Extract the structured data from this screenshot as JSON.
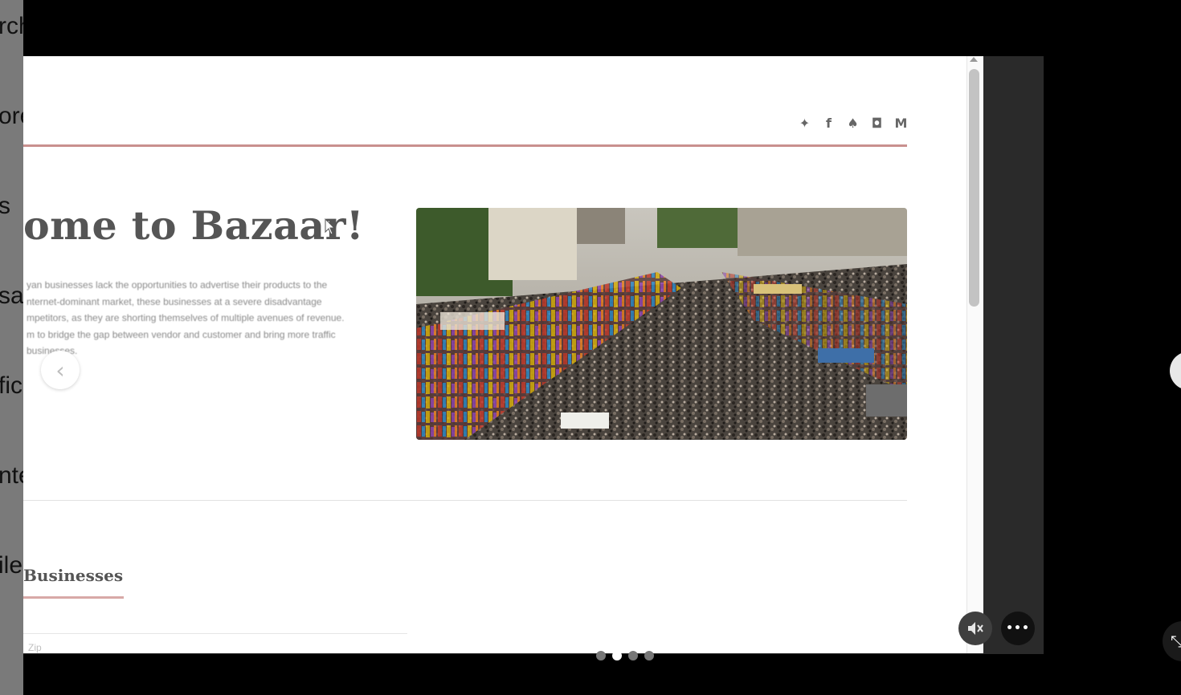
{
  "left_sidebar": {
    "items": [
      "rch",
      "ore",
      "s",
      "sa",
      "fic",
      "nte",
      "ile"
    ]
  },
  "site": {
    "social_icons": [
      {
        "icon": "twitter-icon",
        "glyph": "🐦"
      },
      {
        "icon": "facebook-icon",
        "glyph": "f"
      },
      {
        "icon": "snapchat-icon",
        "glyph": "👻"
      },
      {
        "icon": "instagram-icon",
        "glyph": "◎"
      },
      {
        "icon": "medium-icon",
        "glyph": "M"
      }
    ],
    "social_glyphs": {
      "twitter": "✦",
      "facebook": "f",
      "snapchat": "♠",
      "instagram": "◘",
      "medium": "M"
    },
    "hero_title": "ome to Bazaar!",
    "hero_paragraph": [
      "yan businesses lack the opportunities to advertise their products to the",
      "nternet-dominant market, these businesses at a severe disadvantage",
      "mpetitors, as they are shorting themselves of multiple avenues of revenue.",
      "m to bridge the gap between vendor and customer and bring more traffic",
      " businesses."
    ],
    "section_title": "Businesses",
    "zip_placeholder": "Zip"
  },
  "viewer": {
    "prev_icon": "‹",
    "more_icon": "•••",
    "mute_icon": "🔇",
    "expand_icon": "⤡",
    "slide_count": 4,
    "active_slide": 2
  },
  "colors": {
    "accent_rule": "#c9908e",
    "section_underline": "#d8a9a7",
    "heading": "#555555"
  }
}
